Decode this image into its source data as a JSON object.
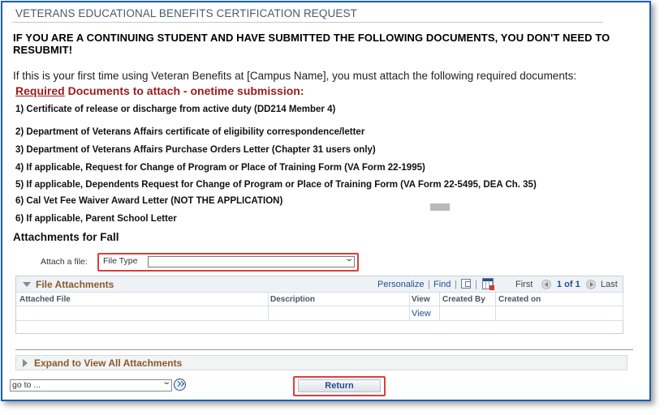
{
  "page": {
    "title": "VETERANS EDUCATIONAL BENEFITS CERTIFICATION REQUEST",
    "notice": "IF YOU ARE A CONTINUING STUDENT AND HAVE SUBMITTED THE FOLLOWING DOCUMENTS, YOU DON'T NEED TO RESUBMIT!",
    "intro": "If this is your first time using Veteran Benefits at [Campus Name], you must attach the following required documents:",
    "required_word": "Required",
    "required_rest": " Documents to attach - onetime submission:"
  },
  "documents": [
    "1) Certificate of release or discharge from active duty (DD214 Member 4)",
    "2) Department of Veterans Affairs certificate of eligibility correspondence/letter",
    "3) Department of Veterans Affairs Purchase Orders Letter (Chapter 31 users only)",
    "4) If applicable, Request for Change of Program or Place of Training Form (VA Form 22-1995)",
    "5) If applicable, Dependents Request for Change of Program or Place of Training Form (VA Form 22-5495, DEA Ch. 35)",
    "6) Cal Vet Fee Waiver Award Letter (NOT THE APPLICATION)",
    "6) If applicable, Parent School Letter"
  ],
  "attachments": {
    "heading": "Attachments for Fall",
    "attach_label": "Attach a file:",
    "file_type_label": "File Type",
    "file_type_value": ""
  },
  "grid": {
    "title": "File Attachments",
    "personalize": "Personalize",
    "find": "Find",
    "sep": "|",
    "first": "First",
    "range": "1 of 1",
    "last": "Last",
    "columns": [
      "Attached File",
      "Description",
      "View",
      "Created By",
      "Created on"
    ],
    "rows": [
      {
        "attached_file": "",
        "description": "",
        "view": "View",
        "created_by": "",
        "created_on": ""
      }
    ]
  },
  "expand": {
    "label": "Expand to View All Attachments"
  },
  "footer": {
    "goto_value": "go to ...",
    "return_label": "Return"
  },
  "colors": {
    "frame": "#1a5fb4",
    "required": "#9b1c1c",
    "link": "#1f4e8c",
    "section_title": "#8b5a2b",
    "highlight": "#e03c3c"
  }
}
